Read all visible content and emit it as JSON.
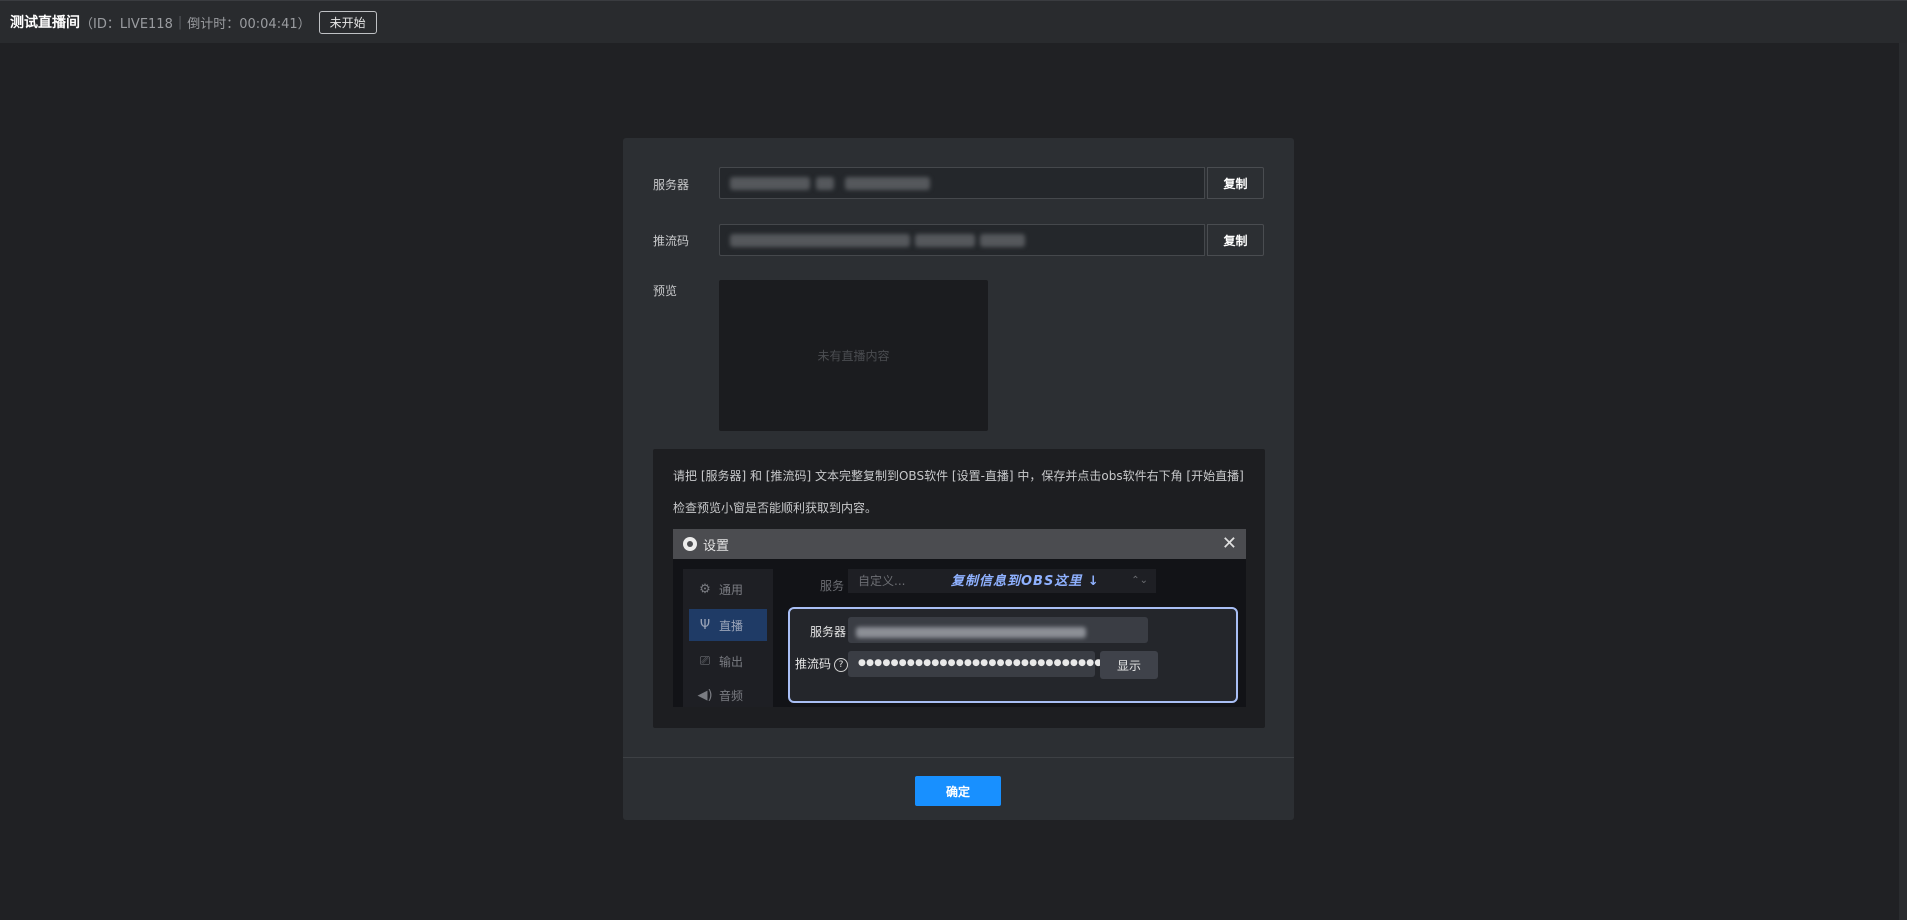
{
  "header": {
    "title": "测试直播间",
    "id_text": "（ID：LIVE118",
    "countdown_text": "倒计时：00:04:41）",
    "status_label": "未开始"
  },
  "dialog": {
    "server_label": "服务器",
    "stream_key_label": "推流码",
    "copy_label": "复制",
    "preview_label": "预览",
    "preview_empty": "未有直播内容",
    "help_line1": "请把 [服务器] 和 [推流码] 文本完整复制到OBS软件 [设置-直播] 中，保存并点击obs软件右下角 [开始直播]",
    "help_line2": "检查预览小窗是否能顺利获取到内容。",
    "confirm_label": "确定"
  },
  "obs": {
    "window_title": "设置",
    "close_glyph": "✕",
    "sidebar": [
      {
        "icon": "gear-icon",
        "glyph": "⚙",
        "label": "通用"
      },
      {
        "icon": "antenna-icon",
        "glyph": "📡",
        "label": "直播"
      },
      {
        "icon": "output-icon",
        "glyph": "⎚",
        "label": "输出"
      },
      {
        "icon": "speaker-icon",
        "glyph": "🔊",
        "label": "音频"
      }
    ],
    "service_label": "服务",
    "service_value": "自定义...",
    "hint": "复制信息到OBS这里 ↓",
    "server_label": "服务器",
    "stream_key_label": "推流码",
    "stream_key_masked": "●●●●●●●●●●●●●●●●●●●●●●●●●●●●●●●●●",
    "help_glyph": "?",
    "show_label": "显示"
  }
}
